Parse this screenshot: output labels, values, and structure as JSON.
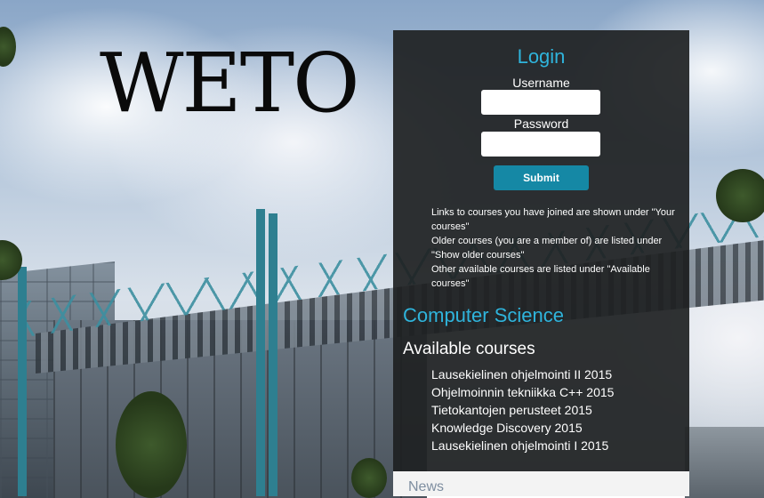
{
  "logo": {
    "text": "WETO"
  },
  "login": {
    "title": "Login",
    "username_label": "Username",
    "username_value": "",
    "password_label": "Password",
    "password_value": "",
    "submit_label": "Submit"
  },
  "info": {
    "lines": [
      "Links to courses you have joined are shown under \"Your courses\"",
      "Older courses (you are a member of) are listed under \"Show older courses\"",
      "Other available courses are listed under \"Available courses\""
    ]
  },
  "department": {
    "title": "Computer Science"
  },
  "available_courses": {
    "title": "Available courses",
    "items": [
      "Lausekielinen ohjelmointi II 2015",
      "Ohjelmoinnin tekniikka C++ 2015",
      "Tietokantojen perusteet 2015",
      "Knowledge Discovery 2015",
      "Lausekielinen ohjelmointi I 2015"
    ]
  },
  "news": {
    "label": "News"
  },
  "colors": {
    "accent": "#2fb4dc",
    "button": "#1588a5",
    "panel": "#1e2122"
  }
}
